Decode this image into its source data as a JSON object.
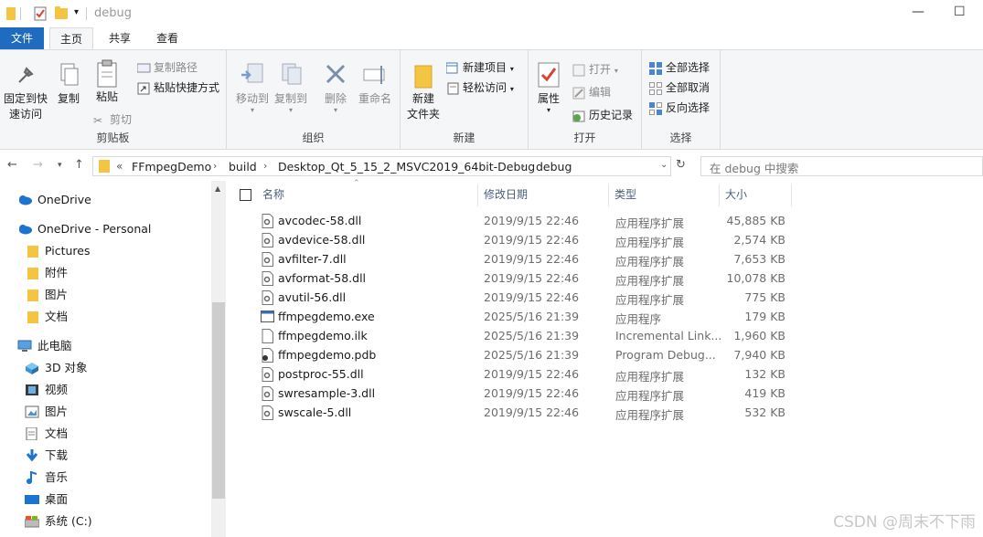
{
  "window": {
    "title": "debug",
    "minimize_glyph": "—",
    "maximize_glyph": "☐"
  },
  "tabs": [
    "文件",
    "主页",
    "共享",
    "查看"
  ],
  "ribbon": {
    "clipboard": {
      "label": "剪贴板",
      "pin": "固定到快速访问",
      "pin1": "固定到快",
      "pin2": "速访问",
      "copy": "复制",
      "paste": "粘贴",
      "cut": "剪切",
      "copy_path": "复制路径",
      "paste_shortcut": "粘贴快捷方式"
    },
    "organize": {
      "label": "组织",
      "move_to": "移动到",
      "copy_to": "复制到",
      "delete": "删除",
      "rename": "重命名"
    },
    "new": {
      "label": "新建",
      "new_folder1": "新建",
      "new_folder2": "文件夹",
      "new_item": "新建项目",
      "easy_access": "轻松访问"
    },
    "open": {
      "label": "打开",
      "properties": "属性",
      "open": "打开",
      "edit": "编辑",
      "history": "历史记录"
    },
    "select": {
      "label": "选择",
      "select_all": "全部选择",
      "select_none": "全部取消",
      "invert": "反向选择"
    }
  },
  "address": {
    "overflow": "«",
    "crumbs": [
      "FFmpegDemo",
      "build",
      "Desktop_Qt_5_15_2_MSVC2019_64bit-Debug",
      "debug"
    ],
    "search_placeholder": "在 debug 中搜索"
  },
  "nav": [
    {
      "label": "OneDrive",
      "icon": "cloud-icon"
    },
    {
      "label": "OneDrive - Personal",
      "icon": "cloud-icon"
    },
    {
      "label": "Pictures",
      "icon": "folder-icon"
    },
    {
      "label": "附件",
      "icon": "folder-icon"
    },
    {
      "label": "图片",
      "icon": "folder-icon"
    },
    {
      "label": "文档",
      "icon": "folder-icon"
    },
    {
      "label": "此电脑",
      "icon": "computer-icon"
    },
    {
      "label": "3D 对象",
      "icon": "3d-objects-icon"
    },
    {
      "label": "视频",
      "icon": "video-icon"
    },
    {
      "label": "图片",
      "icon": "pictures-icon"
    },
    {
      "label": "文档",
      "icon": "documents-icon"
    },
    {
      "label": "下载",
      "icon": "download-icon"
    },
    {
      "label": "音乐",
      "icon": "music-icon"
    },
    {
      "label": "桌面",
      "icon": "desktop-icon"
    },
    {
      "label": "系统 (C:)",
      "icon": "drive-icon"
    }
  ],
  "columns": {
    "name": "名称",
    "modified": "修改日期",
    "type": "类型",
    "size": "大小"
  },
  "files": [
    {
      "name": "avcodec-58.dll",
      "modified": "2019/9/15 22:46",
      "type": "应用程序扩展",
      "size": "45,885 KB",
      "icon": "dll-icon"
    },
    {
      "name": "avdevice-58.dll",
      "modified": "2019/9/15 22:46",
      "type": "应用程序扩展",
      "size": "2,574 KB",
      "icon": "dll-icon"
    },
    {
      "name": "avfilter-7.dll",
      "modified": "2019/9/15 22:46",
      "type": "应用程序扩展",
      "size": "7,653 KB",
      "icon": "dll-icon"
    },
    {
      "name": "avformat-58.dll",
      "modified": "2019/9/15 22:46",
      "type": "应用程序扩展",
      "size": "10,078 KB",
      "icon": "dll-icon"
    },
    {
      "name": "avutil-56.dll",
      "modified": "2019/9/15 22:46",
      "type": "应用程序扩展",
      "size": "775 KB",
      "icon": "dll-icon"
    },
    {
      "name": "ffmpegdemo.exe",
      "modified": "2025/5/16 21:39",
      "type": "应用程序",
      "size": "179 KB",
      "icon": "exe-icon"
    },
    {
      "name": "ffmpegdemo.ilk",
      "modified": "2025/5/16 21:39",
      "type": "Incremental Link...",
      "size": "1,960 KB",
      "icon": "file-icon"
    },
    {
      "name": "ffmpegdemo.pdb",
      "modified": "2025/5/16 21:39",
      "type": "Program Debug...",
      "size": "7,940 KB",
      "icon": "pdb-icon"
    },
    {
      "name": "postproc-55.dll",
      "modified": "2019/9/15 22:46",
      "type": "应用程序扩展",
      "size": "132 KB",
      "icon": "dll-icon"
    },
    {
      "name": "swresample-3.dll",
      "modified": "2019/9/15 22:46",
      "type": "应用程序扩展",
      "size": "419 KB",
      "icon": "dll-icon"
    },
    {
      "name": "swscale-5.dll",
      "modified": "2019/9/15 22:46",
      "type": "应用程序扩展",
      "size": "532 KB",
      "icon": "dll-icon"
    }
  ],
  "watermark": "CSDN @周末不下雨",
  "colors": {
    "file_tab": "#1e6bbf",
    "folder": "#f4c542",
    "header_text": "#4c607a"
  }
}
